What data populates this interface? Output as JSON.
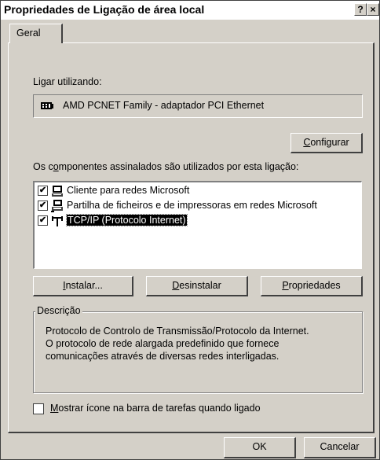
{
  "window": {
    "title": "Propriedades de Ligação de área local",
    "help_btn": "?",
    "close_btn": "×"
  },
  "tabs": [
    {
      "label": "Geral"
    }
  ],
  "connect_using": {
    "label": "Ligar utilizando:",
    "adapter": "AMD PCNET Family - adaptador PCI Ethernet",
    "configure_prefix": "",
    "configure_hot": "C",
    "configure_rest": "onfigurar"
  },
  "components": {
    "label_pre": "Os c",
    "label_hot": "o",
    "label_post": "mponentes assinalados são utilizados por esta ligação:",
    "items": [
      {
        "label": "Cliente para redes Microsoft",
        "checked": "✔",
        "icon": "network-client-icon"
      },
      {
        "label": "Partilha de ficheiros e de impressoras em redes Microsoft",
        "checked": "✔",
        "icon": "file-printer-sharing-icon"
      },
      {
        "label": "TCP/IP (Protocolo Internet)",
        "checked": "✔",
        "icon": "protocol-icon"
      }
    ]
  },
  "buttons": {
    "install_hot": "I",
    "install_rest": "nstalar...",
    "uninstall_hot": "D",
    "uninstall_rest": "esinstalar",
    "properties_hot": "P",
    "properties_rest": "ropriedades"
  },
  "description": {
    "title": "Descrição",
    "text": "Protocolo de Controlo de Transmissão/Protocolo da Internet.\nO protocolo de rede alargada predefinido que fornece\ncomunicações através de diversas redes interligadas."
  },
  "taskbar_option": {
    "checked": "",
    "hot": "M",
    "rest": "ostrar ícone na barra de tarefas quando ligado"
  },
  "footer": {
    "ok": "OK",
    "cancel": "Cancelar"
  }
}
